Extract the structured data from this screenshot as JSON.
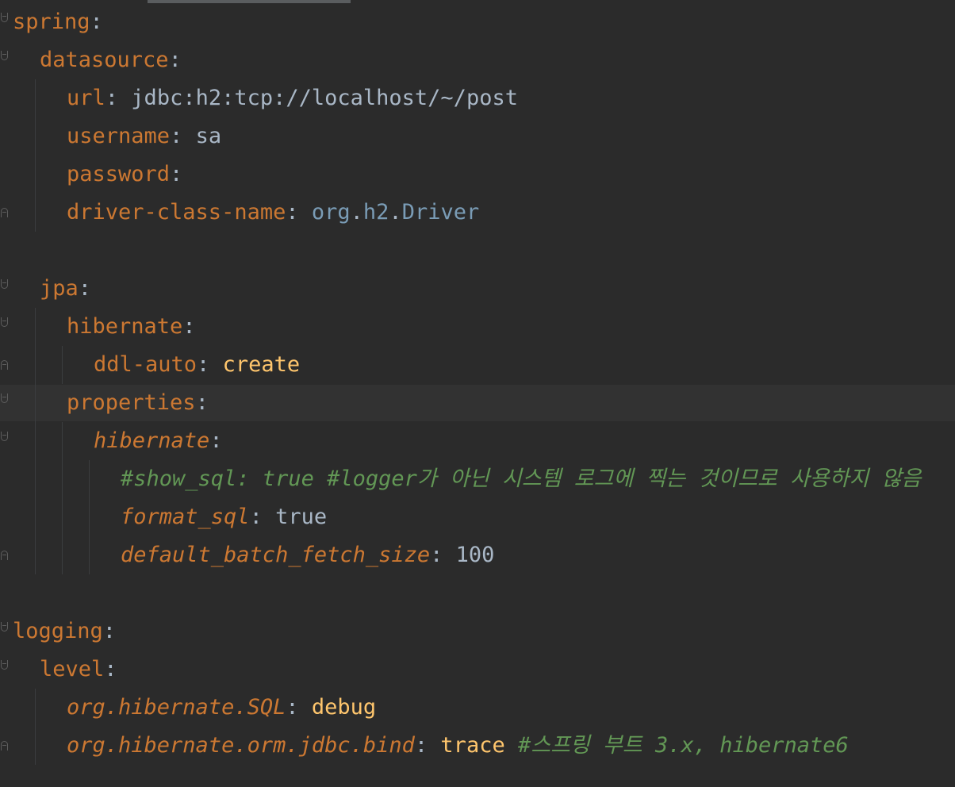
{
  "editor": {
    "language": "yaml",
    "lines": [
      {
        "key": "spring",
        "colon": ":"
      },
      {
        "key": "datasource",
        "colon": ":"
      },
      {
        "key": "url",
        "colon": ":",
        "value": " jdbc:h2:tcp://localhost/~/post"
      },
      {
        "key": "username",
        "colon": ":",
        "value": " sa"
      },
      {
        "key": "password",
        "colon": ":"
      },
      {
        "key": "driver-class-name",
        "colon": ":",
        "value_parts": [
          " org",
          ".",
          "h2",
          ".",
          "Driver"
        ]
      },
      {
        "key": "jpa",
        "colon": ":"
      },
      {
        "key": "hibernate",
        "colon": ":"
      },
      {
        "key": "ddl-auto",
        "colon": ":",
        "value": " create"
      },
      {
        "key": "properties",
        "colon": ":"
      },
      {
        "key": "hibernate",
        "colon": ":"
      },
      {
        "comment": "#show_sql: true #logger가 아닌 시스템 로그에 찍는 것이므로 사용하지 않음"
      },
      {
        "key": "format_sql",
        "colon": ":",
        "value": " true"
      },
      {
        "key": "default_batch_fetch_size",
        "colon": ":",
        "value": " 100"
      },
      {
        "key": "logging",
        "colon": ":"
      },
      {
        "key": "level",
        "colon": ":"
      },
      {
        "key": "org.hibernate.SQL",
        "colon": ":",
        "value": " debug"
      },
      {
        "key": "org.hibernate.orm.jdbc.bind",
        "colon": ":",
        "value": " trace",
        "comment": " #스프링 부트 3.x, hibernate6"
      }
    ]
  }
}
